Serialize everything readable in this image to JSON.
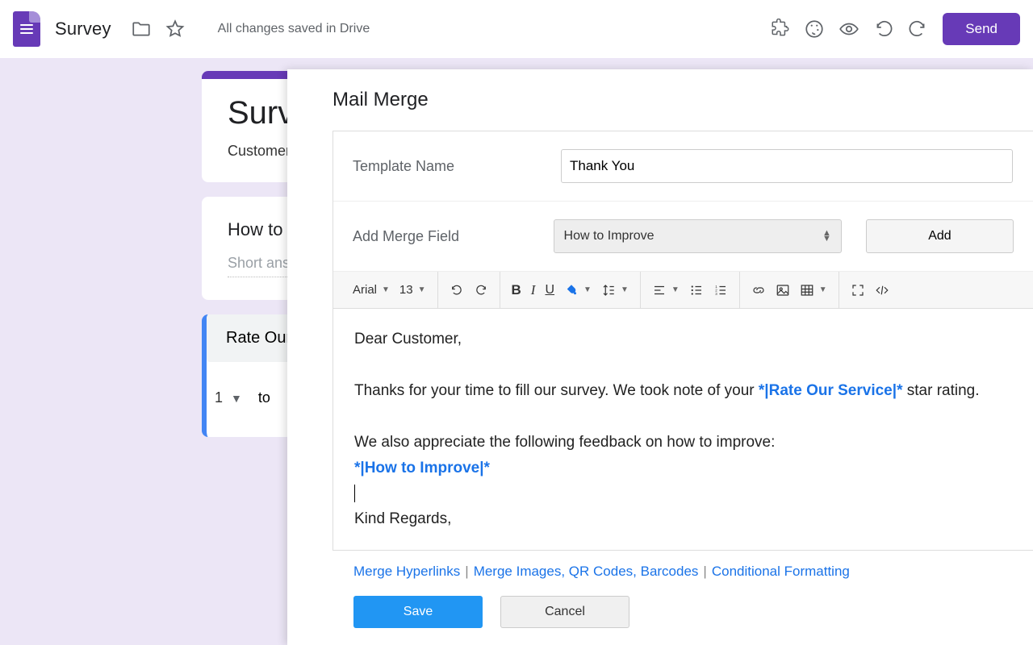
{
  "header": {
    "doc_title": "Survey",
    "save_status": "All changes saved in Drive",
    "send_label": "Send"
  },
  "form": {
    "title": "Survey",
    "description": "Customer Survey",
    "q1": {
      "title": "How to Improve",
      "placeholder": "Short answer text"
    },
    "q2": {
      "title": "Rate Our Service",
      "scale_low": "1",
      "scale_mid": "to"
    }
  },
  "panel": {
    "title": "Mail Merge",
    "template_label": "Template Name",
    "template_value": "Thank You",
    "merge_field_label": "Add Merge Field",
    "merge_field_value": "How to Improve",
    "add_label": "Add",
    "toolbar": {
      "font": "Arial",
      "size": "13"
    },
    "editor": {
      "greeting": "Dear Customer,",
      "l1a": "Thanks for your time to fill our survey. We took note of your ",
      "token1": "*|Rate Our Service|*",
      "l1b": " star rating.",
      "l2": "We also appreciate the following feedback on how to improve:",
      "token2": "*|How to Improve|*",
      "signoff": "Kind Regards,"
    },
    "links": {
      "l1": "Merge Hyperlinks",
      "l2": "Merge Images, QR Codes, Barcodes",
      "l3": "Conditional Formatting"
    },
    "save_label": "Save",
    "cancel_label": "Cancel"
  }
}
